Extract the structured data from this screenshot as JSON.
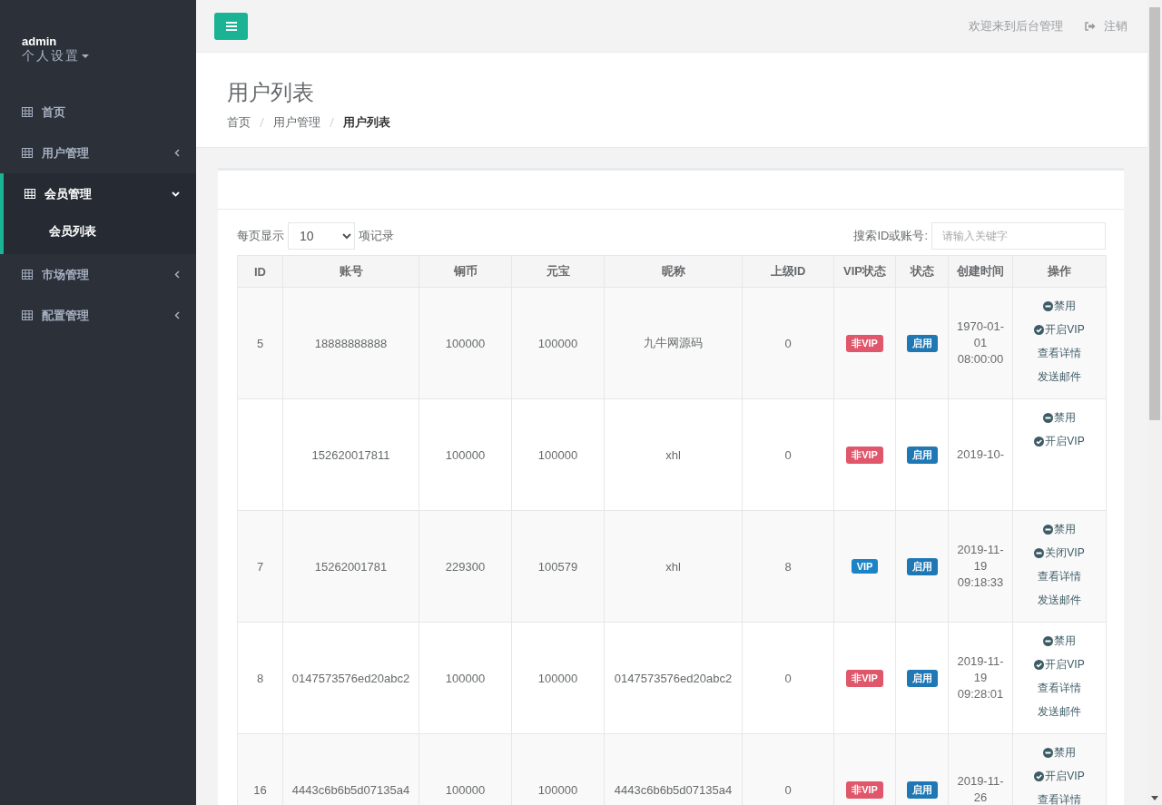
{
  "sidebar": {
    "user": "admin",
    "settings": "个人设置",
    "items": [
      {
        "label": "首页",
        "selected": false
      },
      {
        "label": "用户管理",
        "expanded": false,
        "selected": false
      },
      {
        "label": "会员管理",
        "expanded": true,
        "selected": true,
        "children": [
          {
            "label": "会员列表",
            "selected": true
          }
        ]
      },
      {
        "label": "市场管理",
        "expanded": false,
        "selected": false
      },
      {
        "label": "配置管理",
        "expanded": false,
        "selected": false
      }
    ]
  },
  "topbar": {
    "welcome": "欢迎来到后台管理",
    "logout": "注销"
  },
  "header": {
    "title": "用户列表",
    "breadcrumb": [
      {
        "label": "首页",
        "current": false
      },
      {
        "label": "用户管理",
        "current": false
      },
      {
        "label": "用户列表",
        "current": true
      }
    ]
  },
  "table_controls": {
    "page_size_label": "每页显示",
    "page_size": "10",
    "records_label": "项记录",
    "search_label": "搜索ID或账号:",
    "search_placeholder": "请输入关键字"
  },
  "table": {
    "columns": [
      "ID",
      "账号",
      "铜币",
      "元宝",
      "昵称",
      "上级ID",
      "VIP状态",
      "状态",
      "创建时间",
      "操作"
    ],
    "rows": [
      {
        "id": "5",
        "account": "18888888888",
        "copper": "100000",
        "ingot": "100000",
        "nickname": "九牛网源码",
        "parent_id": "0",
        "vip": {
          "label": "非VIP",
          "on": false
        },
        "status": {
          "label": "启用",
          "enabled": true
        },
        "created": [
          "1970-01-",
          "01",
          "08:00:00"
        ],
        "actions": [
          {
            "kind": "disable",
            "label": "禁用"
          },
          {
            "kind": "vip_on",
            "label": "开启VIP"
          },
          {
            "kind": "detail",
            "label": "查看详情"
          },
          {
            "kind": "mail",
            "label": "发送邮件"
          }
        ]
      },
      {
        "account": "152620017811",
        "copper": "100000",
        "ingot": "100000",
        "nickname": "xhl",
        "parent_id": "0",
        "vip": {
          "label": "非VIP",
          "on": false
        },
        "status": {
          "label": "启用",
          "enabled": true
        },
        "created": [
          "2019-10-"
        ],
        "actions": [
          {
            "kind": "disable",
            "label": "禁用"
          },
          {
            "kind": "vip_on",
            "label": "开启VIP"
          }
        ]
      },
      {
        "id": "7",
        "account": "15262001781",
        "copper": "229300",
        "ingot": "100579",
        "nickname": "xhl",
        "parent_id": "8",
        "vip": {
          "label": "VIP",
          "on": true
        },
        "status": {
          "label": "启用",
          "enabled": true
        },
        "created": [
          "2019-11-",
          "19",
          "09:18:33"
        ],
        "actions": [
          {
            "kind": "disable",
            "label": "禁用"
          },
          {
            "kind": "vip_off",
            "label": "关闭VIP"
          },
          {
            "kind": "detail",
            "label": "查看详情"
          },
          {
            "kind": "mail",
            "label": "发送邮件"
          }
        ]
      },
      {
        "id": "8",
        "account": "0147573576ed20abc2",
        "copper": "100000",
        "ingot": "100000",
        "nickname": "0147573576ed20abc2",
        "parent_id": "0",
        "vip": {
          "label": "非VIP",
          "on": false
        },
        "status": {
          "label": "启用",
          "enabled": true
        },
        "created": [
          "2019-11-",
          "19",
          "09:28:01"
        ],
        "actions": [
          {
            "kind": "disable",
            "label": "禁用"
          },
          {
            "kind": "vip_on",
            "label": "开启VIP"
          },
          {
            "kind": "detail",
            "label": "查看详情"
          },
          {
            "kind": "mail",
            "label": "发送邮件"
          }
        ]
      },
      {
        "id": "16",
        "account": "4443c6b6b5d07135a4",
        "copper": "100000",
        "ingot": "100000",
        "nickname": "4443c6b6b5d07135a4",
        "parent_id": "0",
        "vip": {
          "label": "非VIP",
          "on": false
        },
        "status": {
          "label": "启用",
          "enabled": true
        },
        "created": [
          "2019-11-",
          "26"
        ],
        "actions": [
          {
            "kind": "disable",
            "label": "禁用"
          },
          {
            "kind": "vip_on",
            "label": "开启VIP"
          },
          {
            "kind": "detail",
            "label": "查看详情"
          }
        ]
      }
    ]
  }
}
